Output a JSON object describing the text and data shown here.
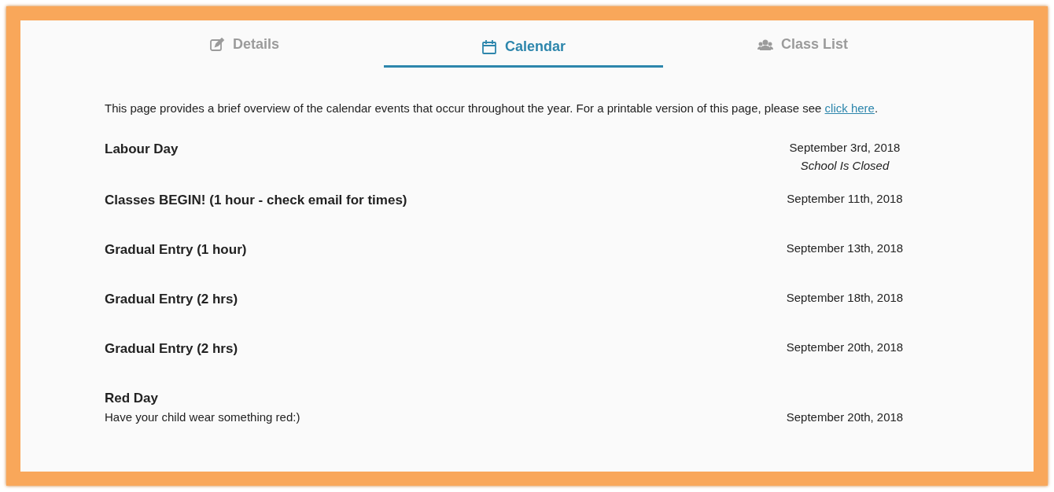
{
  "tabs": [
    {
      "label": "Details",
      "selected": false
    },
    {
      "label": "Calendar",
      "selected": true
    },
    {
      "label": "Class List",
      "selected": false
    }
  ],
  "intro": {
    "before": "This page provides a brief overview of the calendar events that occur throughout the year. For a printable version of this page, please see ",
    "link": "click here",
    "after": "."
  },
  "events": [
    {
      "title": "Labour Day",
      "date": "September 3rd, 2018",
      "date_note": "School Is Closed"
    },
    {
      "title": "Classes BEGIN! (1 hour - check email for times)",
      "date": "September 11th, 2018"
    },
    {
      "title": "Gradual Entry (1 hour)",
      "date": "September 13th, 2018"
    },
    {
      "title": "Gradual Entry (2 hrs)",
      "date": "September 18th, 2018"
    },
    {
      "title": "Gradual Entry (2 hrs)",
      "date": "September 20th, 2018"
    },
    {
      "title": "Red Day",
      "note": "Have your child wear something red:)",
      "date": "September 20th, 2018"
    }
  ]
}
